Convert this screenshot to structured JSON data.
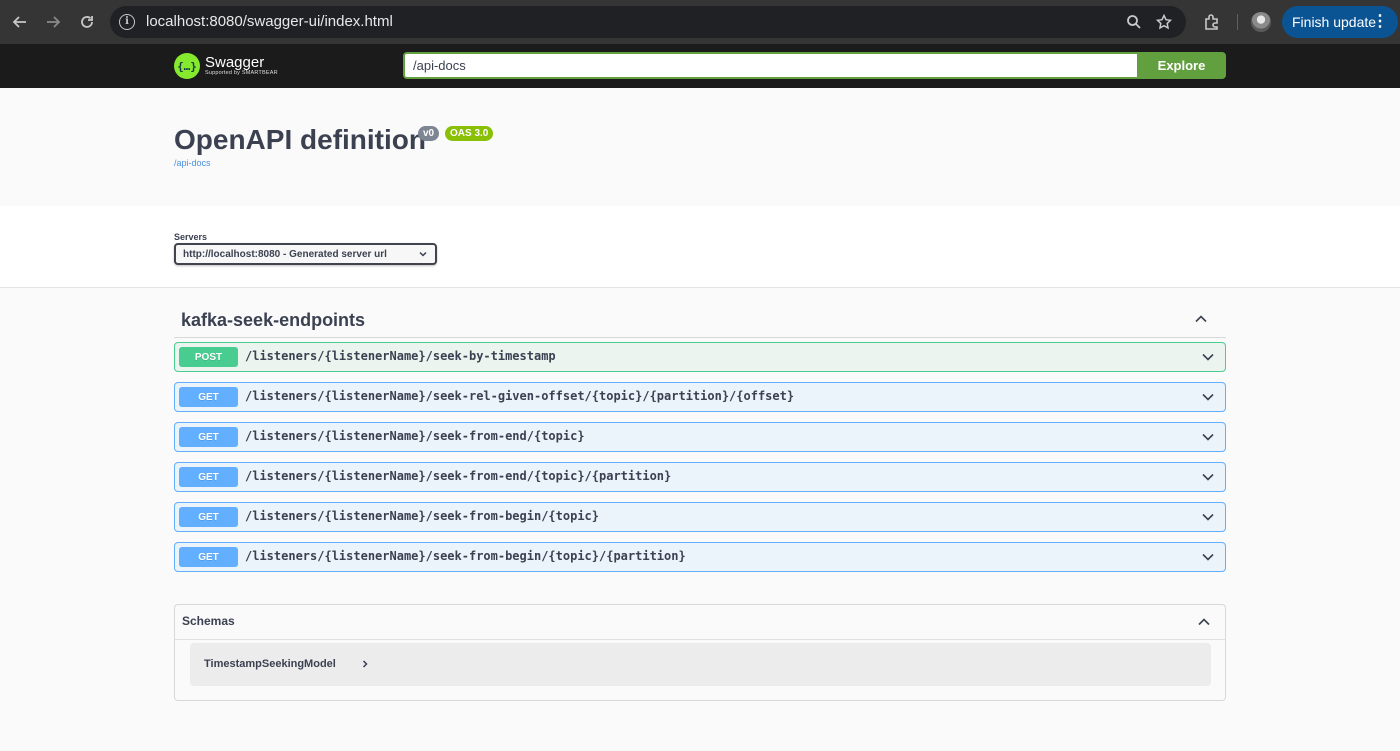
{
  "browser": {
    "url": "localhost:8080/swagger-ui/index.html",
    "finish_update_label": "Finish update"
  },
  "topbar": {
    "logo_name": "Swagger",
    "logo_sub": "Supported by SMARTBEAR",
    "url_value": "/api-docs",
    "explore_label": "Explore"
  },
  "info": {
    "title": "OpenAPI definition",
    "version_badge": "v0",
    "oas_badge": "OAS 3.0",
    "link": "/api-docs"
  },
  "servers": {
    "label": "Servers",
    "selected": "http://localhost:8080 - Generated server url"
  },
  "tag": {
    "name": "kafka-seek-endpoints"
  },
  "operations": [
    {
      "method": "POST",
      "path": "/listeners/{listenerName}/seek-by-timestamp"
    },
    {
      "method": "GET",
      "path": "/listeners/{listenerName}/seek-rel-given-offset/{topic}/{partition}/{offset}"
    },
    {
      "method": "GET",
      "path": "/listeners/{listenerName}/seek-from-end/{topic}"
    },
    {
      "method": "GET",
      "path": "/listeners/{listenerName}/seek-from-end/{topic}/{partition}"
    },
    {
      "method": "GET",
      "path": "/listeners/{listenerName}/seek-from-begin/{topic}"
    },
    {
      "method": "GET",
      "path": "/listeners/{listenerName}/seek-from-begin/{topic}/{partition}"
    }
  ],
  "schemas": {
    "title": "Schemas",
    "models": [
      "TimestampSeekingModel"
    ]
  },
  "colors": {
    "post": "#49cc90",
    "get": "#61affe",
    "explore": "#62a03f",
    "oas_badge": "#89bf04",
    "topbar": "#1b1b1b"
  }
}
